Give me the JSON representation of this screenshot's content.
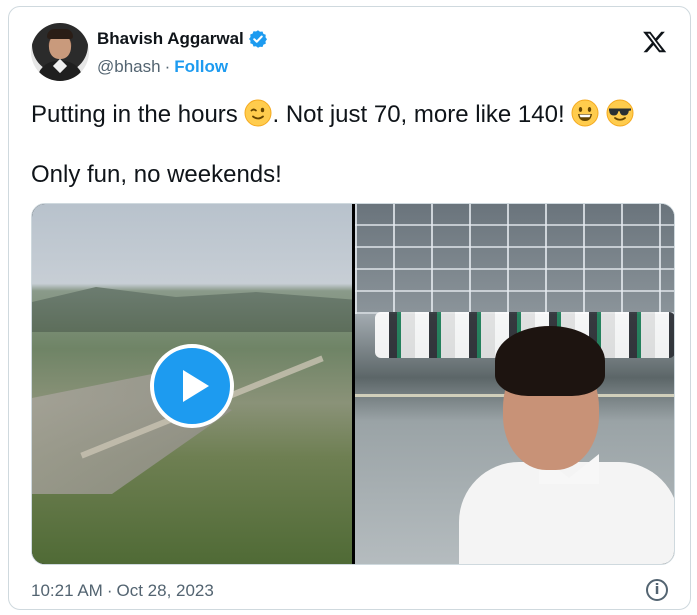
{
  "author": {
    "name": "Bhavish Aggarwal",
    "handle": "@bhash",
    "separator": "·",
    "follow_label": "Follow",
    "verified_icon": "verified-badge-icon",
    "avatar_icon": "profile-avatar"
  },
  "logo": {
    "icon": "x-logo-icon"
  },
  "tweet": {
    "line1_text": "Putting in the hours",
    "line1_after_emoji": ". Not just 70, more like 140!",
    "line2": "Only fun, no weekends!",
    "emojis": [
      "winking-face-emoji",
      "grinning-face-emoji",
      "smiling-face-with-sunglasses-emoji"
    ]
  },
  "media": {
    "left_image": "aerial-factory-site-video",
    "right_image": "factory-floor-selfie-photo",
    "play_icon": "play-icon"
  },
  "footer": {
    "time": "10:21 AM",
    "separator": "·",
    "date": "Oct 28, 2023",
    "info_icon": "info-icon",
    "info_glyph": "i"
  },
  "colors": {
    "accent": "#1d9bf0",
    "text": "#0f1419",
    "muted": "#536471",
    "border": "#cfd9de"
  }
}
